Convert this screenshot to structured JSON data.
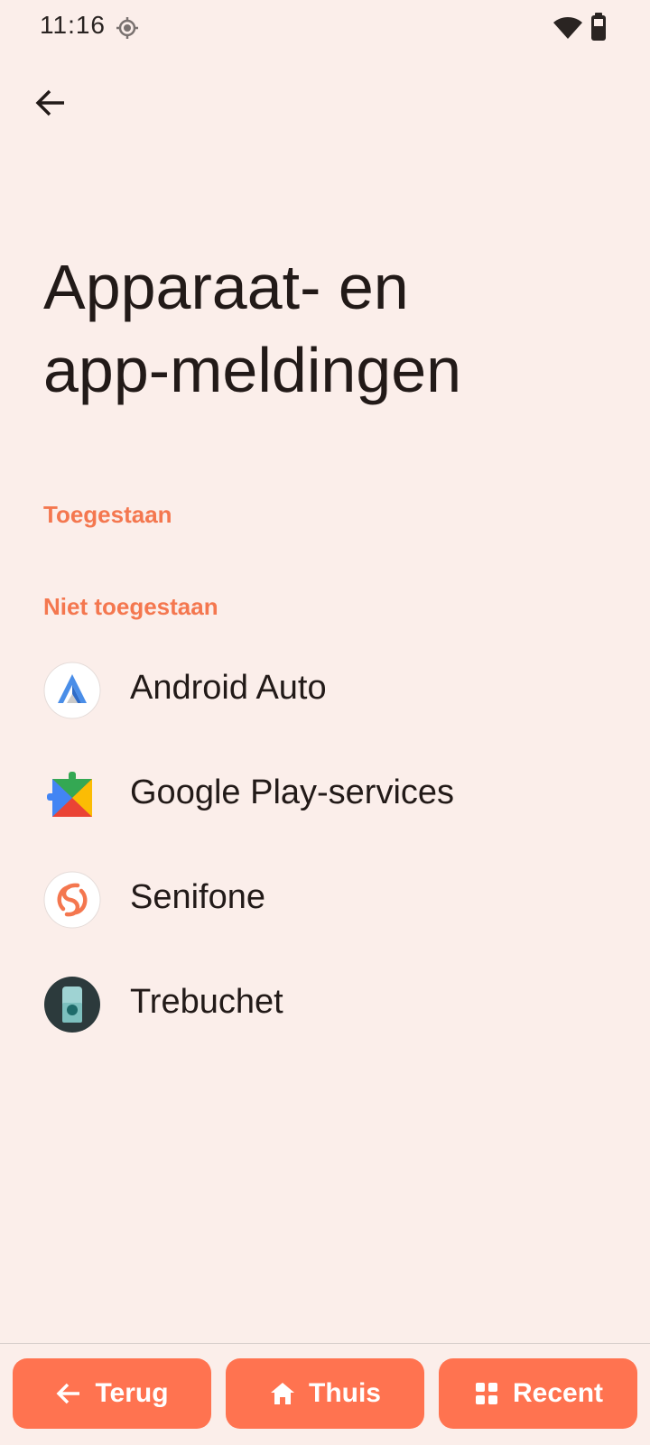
{
  "status_bar": {
    "time": "11:16",
    "icons": [
      "location-icon",
      "wifi-icon",
      "battery-icon"
    ]
  },
  "header": {
    "back_icon": "arrow-left-icon"
  },
  "page": {
    "title_line1": "Apparaat- en",
    "title_line2": "app-meldingen"
  },
  "sections": {
    "allowed_header": "Toegestaan",
    "not_allowed_header": "Niet toegestaan"
  },
  "apps": [
    {
      "label": "Android Auto",
      "icon": "android-auto-icon"
    },
    {
      "label": "Google Play-services",
      "icon": "google-play-services-icon"
    },
    {
      "label": "Senifone",
      "icon": "senifone-icon"
    },
    {
      "label": "Trebuchet",
      "icon": "trebuchet-icon"
    }
  ],
  "nav": {
    "back_label": "Terug",
    "home_label": "Thuis",
    "recent_label": "Recent"
  },
  "colors": {
    "background": "#FBEEEA",
    "accent": "#F4774F",
    "nav_button": "#FF7350",
    "text": "#221A18"
  }
}
